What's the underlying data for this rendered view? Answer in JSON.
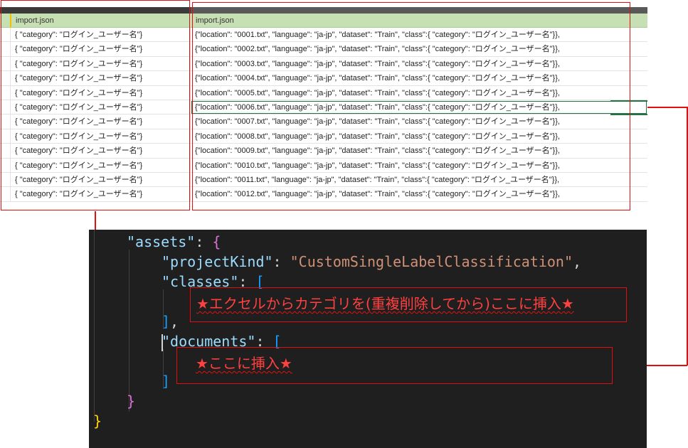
{
  "sheet": {
    "header_a": "import.json",
    "header_b": "import.json",
    "col_a_rows": [
      "{ \"category\": \"ログイン_ユーザー名\"}",
      "{ \"category\": \"ログイン_ユーザー名\"}",
      "{ \"category\": \"ログイン_ユーザー名\"}",
      "{ \"category\": \"ログイン_ユーザー名\"}",
      "{ \"category\": \"ログイン_ユーザー名\"}",
      "{ \"category\": \"ログイン_ユーザー名\"}",
      "{ \"category\": \"ログイン_ユーザー名\"}",
      "{ \"category\": \"ログイン_ユーザー名\"}",
      "{ \"category\": \"ログイン_ユーザー名\"}",
      "{ \"category\": \"ログイン_ユーザー名\"}",
      "{ \"category\": \"ログイン_ユーザー名\"}",
      "{ \"category\": \"ログイン_ユーザー名\"}"
    ],
    "col_b_rows": [
      "{\"location\": \"0001.txt\", \"language\": \"ja-jp\", \"dataset\": \"Train\", \"class\":{ \"category\": \"ログイン_ユーザー名\"}},",
      "{\"location\": \"0002.txt\", \"language\": \"ja-jp\", \"dataset\": \"Train\", \"class\":{ \"category\": \"ログイン_ユーザー名\"}},",
      "{\"location\": \"0003.txt\", \"language\": \"ja-jp\", \"dataset\": \"Train\", \"class\":{ \"category\": \"ログイン_ユーザー名\"}},",
      "{\"location\": \"0004.txt\", \"language\": \"ja-jp\", \"dataset\": \"Train\", \"class\":{ \"category\": \"ログイン_ユーザー名\"}},",
      "{\"location\": \"0005.txt\", \"language\": \"ja-jp\", \"dataset\": \"Train\", \"class\":{ \"category\": \"ログイン_ユーザー名\"}},",
      "{\"location\": \"0006.txt\", \"language\": \"ja-jp\", \"dataset\": \"Train\", \"class\":{ \"category\": \"ログイン_ユーザー名\"}},",
      "{\"location\": \"0007.txt\", \"language\": \"ja-jp\", \"dataset\": \"Train\", \"class\":{ \"category\": \"ログイン_ユーザー名\"}},",
      "{\"location\": \"0008.txt\", \"language\": \"ja-jp\", \"dataset\": \"Train\", \"class\":{ \"category\": \"ログイン_ユーザー名\"}},",
      "{\"location\": \"0009.txt\", \"language\": \"ja-jp\", \"dataset\": \"Train\", \"class\":{ \"category\": \"ログイン_ユーザー名\"}},",
      "{\"location\": \"0010.txt\", \"language\": \"ja-jp\", \"dataset\": \"Train\", \"class\":{ \"category\": \"ログイン_ユーザー名\"}},",
      "{\"location\": \"0011.txt\", \"language\": \"ja-jp\", \"dataset\": \"Train\", \"class\":{ \"category\": \"ログイン_ユーザー名\"}},",
      "{\"location\": \"0012.txt\", \"language\": \"ja-jp\", \"dataset\": \"Train\", \"class\":{ \"category\": \"ログイン_ユーザー名\"}},"
    ],
    "selected_row": 5
  },
  "editor": {
    "assets_key": "\"assets\"",
    "colon_sep": ": ",
    "open_brace": "{",
    "project_kind_key": "\"projectKind\"",
    "project_kind_value": "\"CustomSingleLabelClassification\"",
    "comma": ",",
    "classes_key": "\"classes\"",
    "open_bracket": "[",
    "close_bracket": "]",
    "documents_key": "\"documents\"",
    "close_inner_brace": "}",
    "close_outer_brace": "}"
  },
  "annotations": {
    "classes_note": "★エクセルからカテゴリを(重複削除してから)ここに挿入★",
    "documents_note": "★ここに挿入★"
  },
  "colors": {
    "annotation_red": "#e01010",
    "header_green": "#c6e0b4",
    "editor_bg": "#1f1f1f"
  }
}
